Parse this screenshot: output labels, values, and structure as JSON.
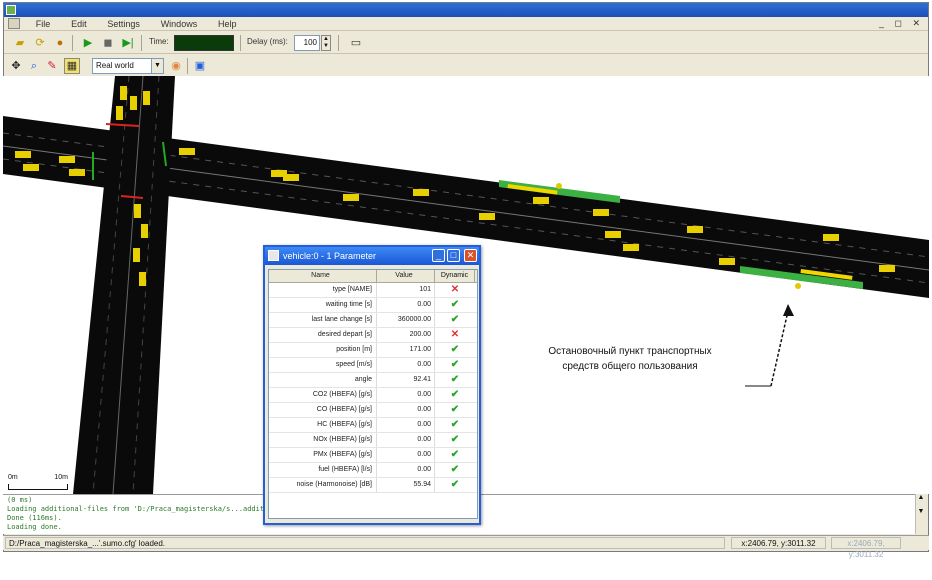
{
  "window": {
    "title": "",
    "menu": [
      "File",
      "Edit",
      "Settings",
      "Windows",
      "Help"
    ],
    "mdi_controls": "_ ◻ ✕"
  },
  "toolbar": {
    "time_label": "Time:",
    "time_value": "",
    "delay_label": "Delay (ms):",
    "delay_value": "100",
    "view_select": "Real world"
  },
  "status": {
    "log_lines": [
      "(0 ms)",
      "Loading additional-files from 'D:/Praca_magisterska/s...additional.add.xml' ... done",
      "Done (116ms).",
      "Loading done."
    ],
    "message": "D:/Praca_magisterska_...'.sumo.cfg' loaded.",
    "coords": "x:2406.79, y:3011.32",
    "extra": "x:2406.79, y:3011.32"
  },
  "scale": {
    "left_label": "0m",
    "right_label": "10m"
  },
  "annotation": {
    "line1": "Остановочный пункт транспортных",
    "line2": "средств общего пользования"
  },
  "dialog": {
    "title": "vehicle:0 - 1 Parameter",
    "columns": {
      "name": "Name",
      "value": "Value",
      "dynamic": "Dynamic"
    },
    "rows": [
      {
        "name": "type [NAME]",
        "value": "101",
        "dynamic": false
      },
      {
        "name": "waiting time [s]",
        "value": "0.00",
        "dynamic": true
      },
      {
        "name": "last lane change [s]",
        "value": "360000.00",
        "dynamic": true
      },
      {
        "name": "desired depart [s]",
        "value": "200.00",
        "dynamic": false
      },
      {
        "name": "position [m]",
        "value": "171.00",
        "dynamic": true
      },
      {
        "name": "speed [m/s]",
        "value": "0.00",
        "dynamic": true
      },
      {
        "name": "angle",
        "value": "92.41",
        "dynamic": true
      },
      {
        "name": "CO2 (HBEFA) [g/s]",
        "value": "0.00",
        "dynamic": true
      },
      {
        "name": "CO (HBEFA) [g/s]",
        "value": "0.00",
        "dynamic": true
      },
      {
        "name": "HC (HBEFA) [g/s]",
        "value": "0.00",
        "dynamic": true
      },
      {
        "name": "NOx (HBEFA) [g/s]",
        "value": "0.00",
        "dynamic": true
      },
      {
        "name": "PMx (HBEFA) [g/s]",
        "value": "0.00",
        "dynamic": true
      },
      {
        "name": "fuel (HBEFA) [l/s]",
        "value": "0.00",
        "dynamic": true
      },
      {
        "name": "noise (Harmonoise) [dB]",
        "value": "55.94",
        "dynamic": true
      }
    ],
    "dynamic_symbols": {
      "yes": "✔",
      "no": "✕"
    }
  }
}
